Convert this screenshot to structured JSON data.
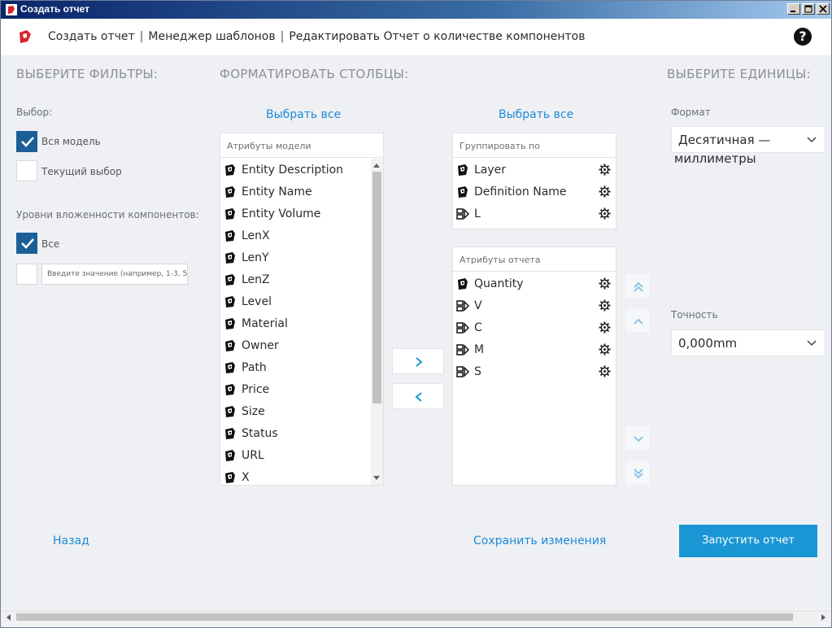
{
  "window": {
    "title": "Создать отчет",
    "brand_color": "#d9222a"
  },
  "header": {
    "breadcrumb": [
      "Создать отчет",
      "Менеджер шаблонов",
      "Редактировать Отчет о количестве компонентов"
    ],
    "separator": "|",
    "help_icon": "?"
  },
  "filters": {
    "title": "ВЫБЕРИТЕ ФИЛЬТРЫ:",
    "selection_label": "Выбор:",
    "selection_options": [
      {
        "label": "Вся модель",
        "checked": true
      },
      {
        "label": "Текущий выбор",
        "checked": false
      }
    ],
    "nesting_label": "Уровни вложенности компонентов:",
    "nesting_options": [
      {
        "label": "Все",
        "checked": true
      }
    ],
    "nesting_input_placeholder": "Введите значение (например, 1-3, 5"
  },
  "columns": {
    "title": "ФОРМАТИРОВАТЬ СТОЛБЦЫ:",
    "select_all_left": "Выбрать все",
    "select_all_right": "Выбрать все",
    "model_attributes": {
      "header": "Атрибуты модели",
      "items": [
        {
          "label": "Entity Description",
          "icon": "sketchup-icon"
        },
        {
          "label": "Entity Name",
          "icon": "sketchup-icon"
        },
        {
          "label": "Entity Volume",
          "icon": "sketchup-icon"
        },
        {
          "label": "LenX",
          "icon": "sketchup-icon"
        },
        {
          "label": "LenY",
          "icon": "sketchup-icon"
        },
        {
          "label": "LenZ",
          "icon": "sketchup-icon"
        },
        {
          "label": "Level",
          "icon": "sketchup-icon"
        },
        {
          "label": "Material",
          "icon": "sketchup-icon"
        },
        {
          "label": "Owner",
          "icon": "sketchup-icon"
        },
        {
          "label": "Path",
          "icon": "sketchup-icon"
        },
        {
          "label": "Price",
          "icon": "sketchup-icon"
        },
        {
          "label": "Size",
          "icon": "sketchup-icon"
        },
        {
          "label": "Status",
          "icon": "sketchup-icon"
        },
        {
          "label": "URL",
          "icon": "sketchup-icon"
        },
        {
          "label": "X",
          "icon": "sketchup-icon"
        }
      ]
    },
    "group_by": {
      "header": "Группировать по",
      "items": [
        {
          "label": "Layer",
          "icon": "sketchup-icon"
        },
        {
          "label": "Definition Name",
          "icon": "sketchup-icon"
        },
        {
          "label": "L",
          "icon": "dynamic-attribute-icon"
        }
      ]
    },
    "report_attributes": {
      "header": "Атрибуты отчета",
      "items": [
        {
          "label": "Quantity",
          "icon": "sketchup-icon"
        },
        {
          "label": "V",
          "icon": "dynamic-attribute-icon"
        },
        {
          "label": "C",
          "icon": "dynamic-attribute-icon"
        },
        {
          "label": "M",
          "icon": "dynamic-attribute-icon"
        },
        {
          "label": "S",
          "icon": "dynamic-attribute-icon"
        }
      ]
    }
  },
  "units": {
    "title": "ВЫБЕРИТЕ ЕДИНИЦЫ:",
    "format_label": "Формат",
    "format_value_line1": "Десятичная —",
    "format_value_line2": "миллиметры",
    "precision_label": "Точность",
    "precision_value": "0,000mm"
  },
  "footer": {
    "back": "Назад",
    "save": "Сохранить изменения",
    "run": "Запустить отчет"
  },
  "colors": {
    "accent": "#1a96d4",
    "link": "#1d8ad8",
    "checkbox": "#1b5f96"
  }
}
